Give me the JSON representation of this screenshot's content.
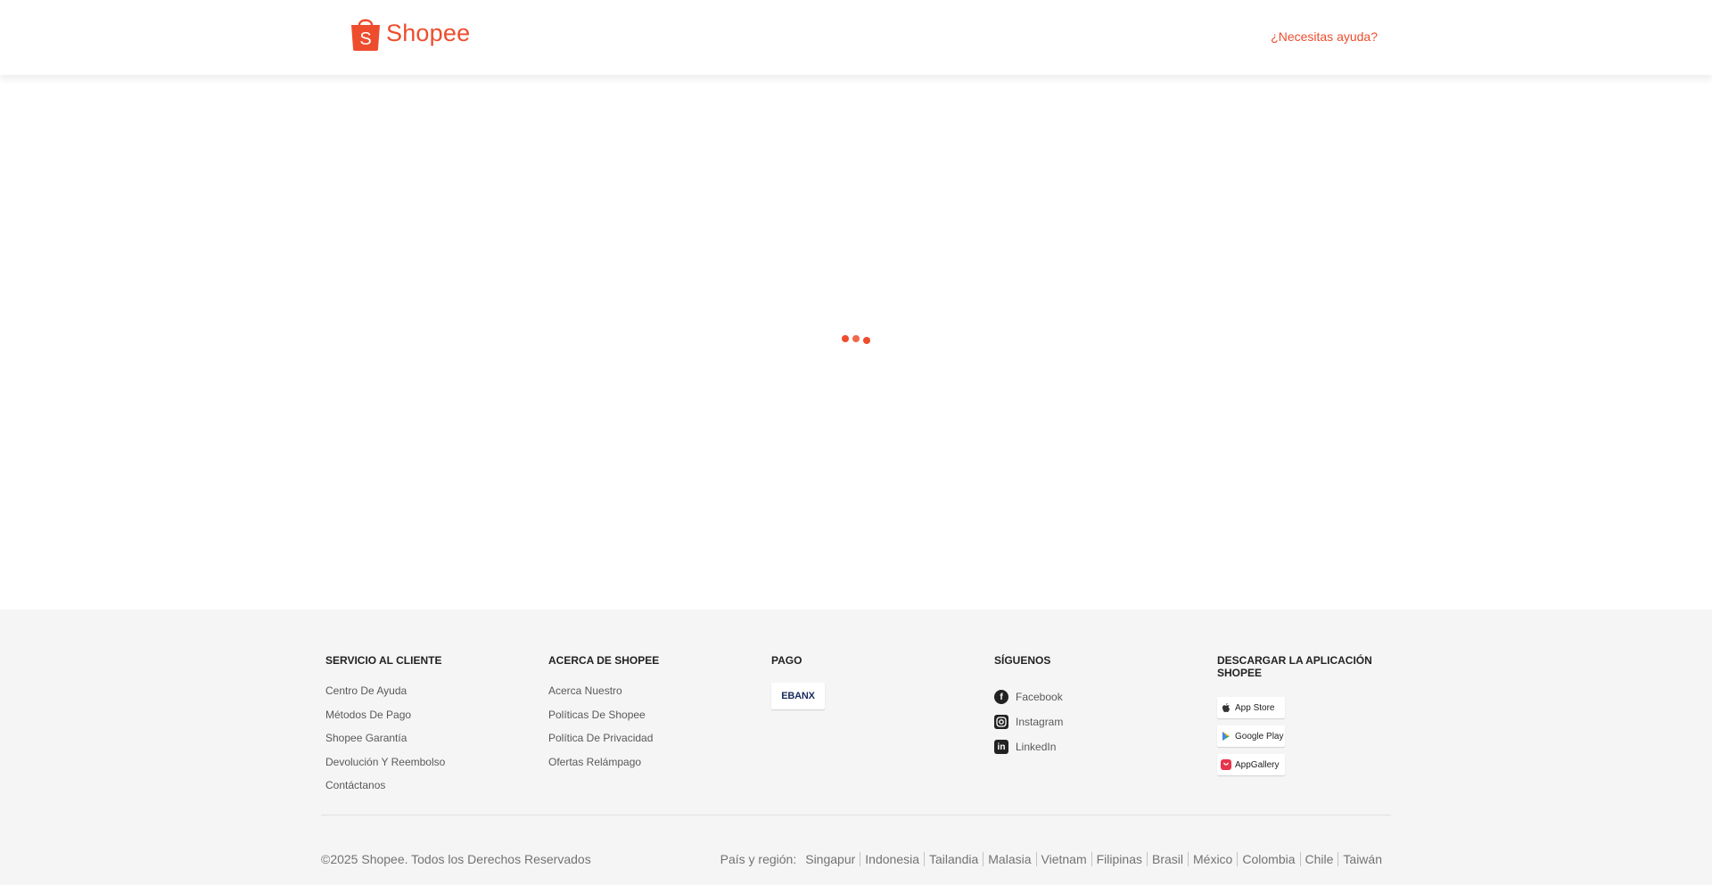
{
  "header": {
    "brand": "Shopee",
    "help_label": "¿Necesitas ayuda?"
  },
  "colors": {
    "brand": "#ee4d2d",
    "footer_bg": "#f5f5f5"
  },
  "footer": {
    "customer_service": {
      "title": "SERVICIO AL CLIENTE",
      "links": [
        "Centro De Ayuda",
        "Métodos De Pago",
        "Shopee Garantía",
        "Devolución Y Reembolso",
        "Contáctanos"
      ]
    },
    "about": {
      "title": "ACERCA DE SHOPEE",
      "links": [
        "Acerca Nuestro",
        "Políticas De Shopee",
        "Política De Privacidad",
        "Ofertas Relámpago"
      ]
    },
    "payment": {
      "title": "PAGO",
      "provider": "EBANX"
    },
    "follow": {
      "title": "SÍGUENOS",
      "links": [
        {
          "label": "Facebook",
          "icon": "facebook-icon"
        },
        {
          "label": "Instagram",
          "icon": "instagram-icon"
        },
        {
          "label": "LinkedIn",
          "icon": "linkedin-icon"
        }
      ]
    },
    "download": {
      "title": "DESCARGAR LA APLICACIÓN SHOPEE",
      "stores": [
        {
          "label": "App Store",
          "icon": "apple-icon"
        },
        {
          "label": "Google Play",
          "icon": "google-play-icon"
        },
        {
          "label": "AppGallery",
          "icon": "appgallery-icon"
        }
      ]
    },
    "copyright": "©2025 Shopee. Todos los Derechos Reservados",
    "country_label": "País y región:",
    "countries": [
      "Singapur",
      "Indonesia",
      "Tailandia",
      "Malasia",
      "Vietnam",
      "Filipinas",
      "Brasil",
      "México",
      "Colombia",
      "Chile",
      "Taiwán"
    ]
  }
}
